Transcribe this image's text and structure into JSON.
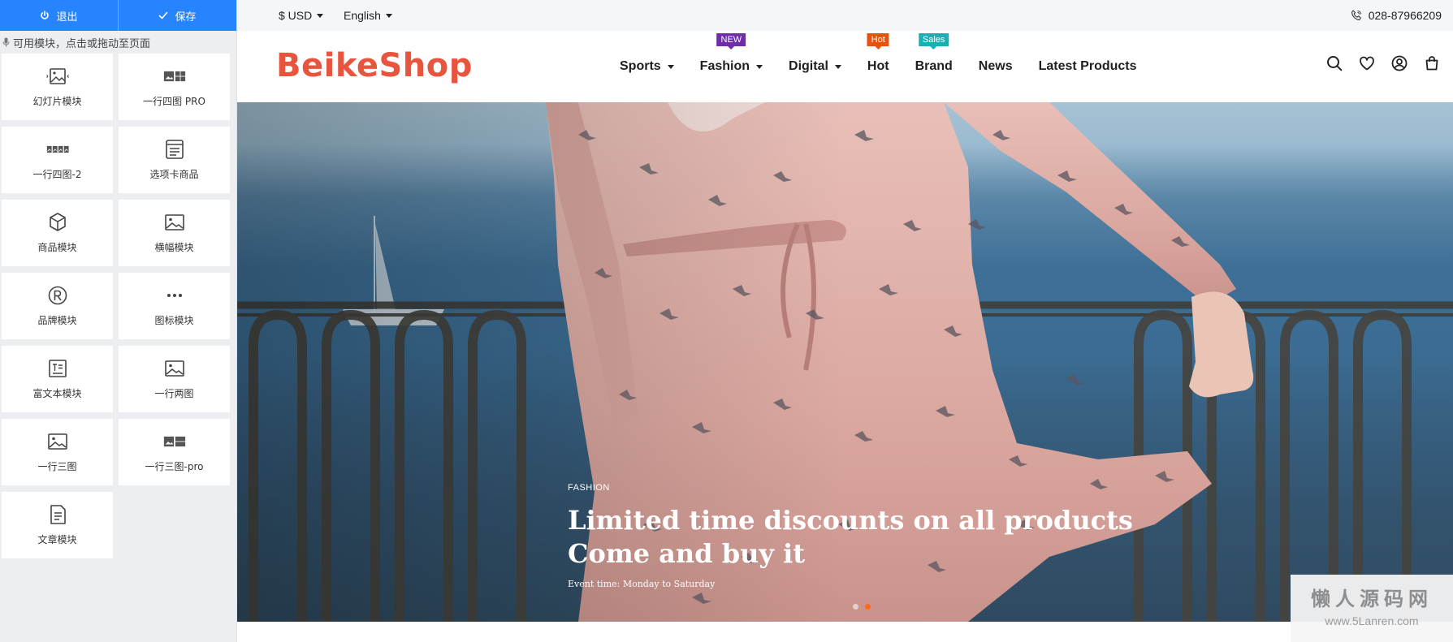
{
  "editor": {
    "exit_label": "退出",
    "save_label": "保存",
    "hint": "可用模块，点击或拖动至页面",
    "modules": [
      {
        "label": "幻灯片模块",
        "icon": "slideshow-icon"
      },
      {
        "label": "一行四图 PRO",
        "icon": "four-images-pro-icon"
      },
      {
        "label": "一行四图-2",
        "icon": "four-images-icon"
      },
      {
        "label": "选项卡商品",
        "icon": "tab-products-icon"
      },
      {
        "label": "商品模块",
        "icon": "product-box-icon"
      },
      {
        "label": "横幅模块",
        "icon": "banner-image-icon"
      },
      {
        "label": "品牌模块",
        "icon": "registered-brand-icon"
      },
      {
        "label": "图标模块",
        "icon": "ellipsis-icon"
      },
      {
        "label": "富文本模块",
        "icon": "rich-text-icon"
      },
      {
        "label": "一行两图",
        "icon": "two-images-icon"
      },
      {
        "label": "一行三图",
        "icon": "three-images-icon"
      },
      {
        "label": "一行三图-pro",
        "icon": "three-images-pro-icon"
      },
      {
        "label": "文章模块",
        "icon": "article-icon"
      }
    ]
  },
  "shop": {
    "currency": "$ USD",
    "language": "English",
    "phone": "028-87966209",
    "logo": "BeikeShop",
    "nav": [
      {
        "label": "Sports",
        "caret": true
      },
      {
        "label": "Fashion",
        "caret": true,
        "badge": "NEW",
        "badge_color": "#6f2da8"
      },
      {
        "label": "Digital",
        "caret": true
      },
      {
        "label": "Hot",
        "badge": "Hot",
        "badge_color": "#e8520f"
      },
      {
        "label": "Brand",
        "badge": "Sales",
        "badge_color": "#17b1b4"
      },
      {
        "label": "News"
      },
      {
        "label": "Latest Products"
      }
    ],
    "header_icons": [
      "search-icon",
      "heart-icon",
      "user-icon",
      "cart-icon"
    ],
    "hero": {
      "category": "FASHION",
      "title_line1": "Limited time discounts on all products",
      "title_line2": "Come and buy it",
      "subtitle": "Event time: Monday to Saturday",
      "slides": 2,
      "active_slide": 2
    }
  },
  "watermark": {
    "line1": "懒人源码网",
    "line2": "www.5Lanren.com"
  },
  "colors": {
    "accent_blue": "#2684ff",
    "logo_red": "#e8553e",
    "active_dot": "#ff6a1a"
  }
}
